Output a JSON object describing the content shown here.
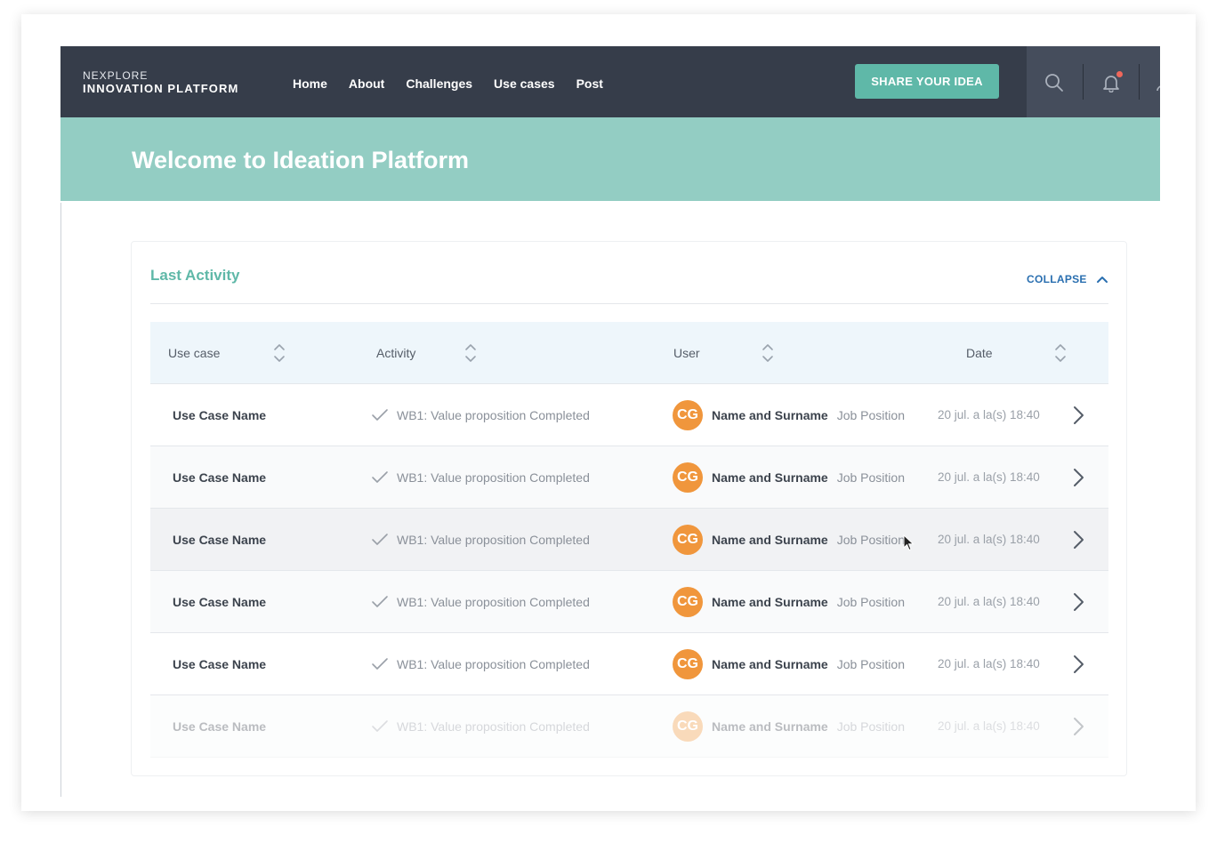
{
  "brand": {
    "top": "NEXPLORE",
    "bottom": "INNOVATION PLATFORM"
  },
  "nav": {
    "links": [
      "Home",
      "About",
      "Challenges",
      "Use cases",
      "Post"
    ],
    "share_label": "SHARE YOUR IDEA",
    "icons": [
      "search-icon",
      "bell-icon",
      "user-icon"
    ]
  },
  "hero": {
    "title": "Welcome to Ideation Platform"
  },
  "activity": {
    "title": "Last Activity",
    "collapse_label": "COLLAPSE",
    "columns": [
      "Use case",
      "Activity",
      "User",
      "Date"
    ],
    "rows": [
      {
        "use_case": "Use Case Name",
        "activity": "WB1: Value proposition Completed",
        "initials": "CG",
        "user": "Name and Surname",
        "position": "Job Position",
        "date": "20 jul. a la(s) 18:40"
      },
      {
        "use_case": "Use Case Name",
        "activity": "WB1: Value proposition Completed",
        "initials": "CG",
        "user": "Name and Surname",
        "position": "Job Position",
        "date": "20 jul. a la(s) 18:40"
      },
      {
        "use_case": "Use Case Name",
        "activity": "WB1: Value proposition Completed",
        "initials": "CG",
        "user": "Name and Surname",
        "position": "Job Position",
        "date": "20 jul. a la(s) 18:40"
      },
      {
        "use_case": "Use Case Name",
        "activity": "WB1: Value proposition Completed",
        "initials": "CG",
        "user": "Name and Surname",
        "position": "Job Position",
        "date": "20 jul. a la(s) 18:40"
      },
      {
        "use_case": "Use Case Name",
        "activity": "WB1: Value proposition Completed",
        "initials": "CG",
        "user": "Name and Surname",
        "position": "Job Position",
        "date": "20 jul. a la(s) 18:40"
      },
      {
        "use_case": "Use Case Name",
        "activity": "WB1: Value proposition Completed",
        "initials": "CG",
        "user": "Name and Surname",
        "position": "Job Position",
        "date": "20 jul. a la(s) 18:40"
      }
    ]
  },
  "colors": {
    "navbar": "#363d4a",
    "accent": "#5fb8a8",
    "hero": "#93cdc3",
    "avatar": "#f0963c",
    "link": "#2a6fb0",
    "notification": "#f0675b"
  }
}
